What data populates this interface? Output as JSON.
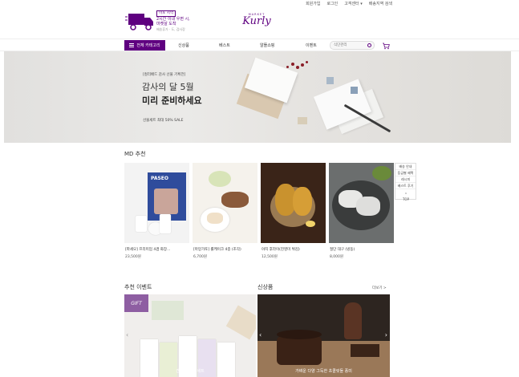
{
  "top_links": [
    "회원가입",
    "로그인",
    "고객센터 ▾",
    "배송지역 검색"
  ],
  "delivery": {
    "tag": "미포 지역",
    "line1": "2시간 이내 우편 시,",
    "line2": "마켓살 도착",
    "line3": "배송휴가 · 도, 검사장"
  },
  "logo": {
    "small": "MARKET",
    "main": "Kurly"
  },
  "nav": {
    "all_categories": "전체 카테고리",
    "items": [
      "신상품",
      "베스트",
      "알뜰쇼핑",
      "이벤트"
    ],
    "search_placeholder": "식단관리"
  },
  "banner": {
    "label": "[컬리배드 감사 선물 기획전]",
    "title_line1": "감사의 달 5월",
    "title_line2": "미리 준비하세요",
    "sub": "선물세트 최대 50% SALE"
  },
  "md_section": {
    "title": "MD 추천",
    "products": [
      {
        "name": "[파세오] 프리미엄 4겹 화장...",
        "price": "23,500원",
        "brand": "PASEO"
      },
      {
        "name": "[마망가토] 롤케이크 4종 (조각)",
        "price": "6,700원"
      },
      {
        "name": "야지 후라이(진영미 튀김)",
        "price": "12,500원"
      },
      {
        "name": "절단 대구 (냉동)",
        "price": "8,000원"
      }
    ]
  },
  "side_widget": {
    "items": [
      "배송 안내",
      "등급별 혜택",
      "레시피",
      "베스트 후기"
    ],
    "top": "TOP"
  },
  "events_section": {
    "title": "추천 이벤트",
    "badge": "GIFT",
    "caption": "간식들 선물 세트"
  },
  "new_section": {
    "title": "신상품",
    "more": "더보기 >",
    "caption": "가벼운 다양 그득한 초콜릿들 풍미"
  },
  "colors": {
    "brand_purple": "#5f0080"
  }
}
